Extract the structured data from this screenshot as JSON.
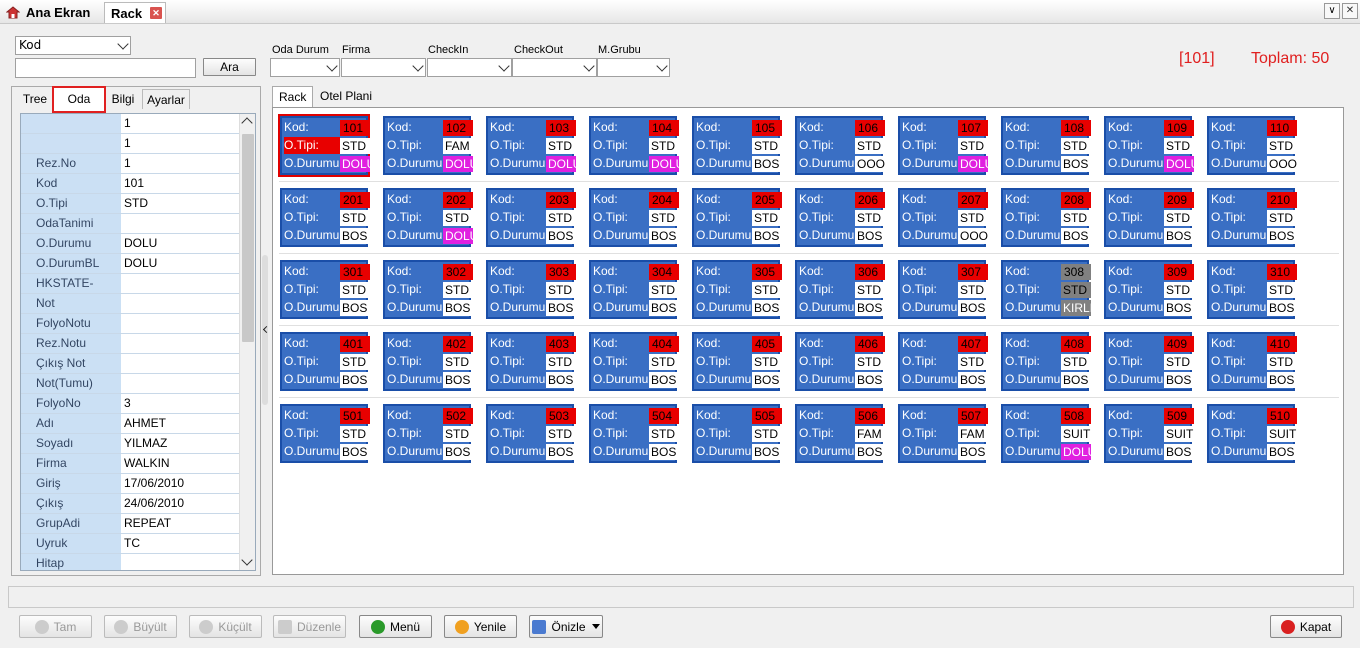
{
  "titlebar": {
    "home_label": "Ana Ekran",
    "rack_label": "Rack",
    "close_glyph": "✕",
    "min_glyph": "∨",
    "x_glyph": "✕"
  },
  "filter": {
    "kod_select": "Kod",
    "search_value": "",
    "ara_label": "Ara",
    "labels": [
      "Oda Durum",
      "Firma",
      "CheckIn",
      "CheckOut",
      "M.Grubu"
    ],
    "selected_room": "[101]",
    "total": "Toplam: 50"
  },
  "left": {
    "tabs": [
      "Tree",
      "Oda",
      "Bilgi",
      "Ayarlar"
    ],
    "rows": [
      {
        "k": "",
        "v": "1"
      },
      {
        "k": "",
        "v": "1"
      },
      {
        "k": "Rez.No",
        "v": "1"
      },
      {
        "k": "Kod",
        "v": "101"
      },
      {
        "k": "O.Tipi",
        "v": "STD"
      },
      {
        "k": "OdaTanimi",
        "v": ""
      },
      {
        "k": "O.Durumu",
        "v": "DOLU"
      },
      {
        "k": "O.DurumBL",
        "v": "DOLU"
      },
      {
        "k": "HKSTATE-",
        "v": ""
      },
      {
        "k": "Not",
        "v": ""
      },
      {
        "k": "FolyoNotu",
        "v": ""
      },
      {
        "k": "Rez.Notu",
        "v": ""
      },
      {
        "k": "Çıkış Not",
        "v": ""
      },
      {
        "k": "Not(Tumu)",
        "v": ""
      },
      {
        "k": "FolyoNo",
        "v": "3"
      },
      {
        "k": "Adı",
        "v": "AHMET"
      },
      {
        "k": "Soyadı",
        "v": "YILMAZ"
      },
      {
        "k": "Firma",
        "v": "WALKIN"
      },
      {
        "k": "Giriş",
        "v": "17/06/2010"
      },
      {
        "k": "Çıkış",
        "v": "24/06/2010"
      },
      {
        "k": "GrupAdi",
        "v": "REPEAT"
      },
      {
        "k": "Uyruk",
        "v": "TC"
      },
      {
        "k": "Hitap",
        "v": ""
      }
    ]
  },
  "rack": {
    "tabs": [
      "Rack",
      "Otel Plani"
    ],
    "labels": {
      "kod": "Kod:",
      "tip": "O.Tipi:",
      "dur": "O.Durumu:"
    },
    "floors": [
      [
        [
          "101",
          "STD",
          "DOLU"
        ],
        [
          "102",
          "FAM",
          "DOLU"
        ],
        [
          "103",
          "STD",
          "DOLU"
        ],
        [
          "104",
          "STD",
          "DOLU"
        ],
        [
          "105",
          "STD",
          "BOS"
        ],
        [
          "106",
          "STD",
          "OOO"
        ],
        [
          "107",
          "STD",
          "DOLU"
        ],
        [
          "108",
          "STD",
          "BOS"
        ],
        [
          "109",
          "STD",
          "DOLU"
        ],
        [
          "110",
          "STD",
          "OOO"
        ]
      ],
      [
        [
          "201",
          "STD",
          "BOS"
        ],
        [
          "202",
          "STD",
          "DOLU"
        ],
        [
          "203",
          "STD",
          "BOS"
        ],
        [
          "204",
          "STD",
          "BOS"
        ],
        [
          "205",
          "STD",
          "BOS"
        ],
        [
          "206",
          "STD",
          "BOS"
        ],
        [
          "207",
          "STD",
          "OOO"
        ],
        [
          "208",
          "STD",
          "BOS"
        ],
        [
          "209",
          "STD",
          "BOS"
        ],
        [
          "210",
          "STD",
          "BOS"
        ]
      ],
      [
        [
          "301",
          "STD",
          "BOS"
        ],
        [
          "302",
          "STD",
          "BOS"
        ],
        [
          "303",
          "STD",
          "BOS"
        ],
        [
          "304",
          "STD",
          "BOS"
        ],
        [
          "305",
          "STD",
          "BOS"
        ],
        [
          "306",
          "STD",
          "BOS"
        ],
        [
          "307",
          "STD",
          "BOS"
        ],
        [
          "308",
          "STD",
          "KIRLI"
        ],
        [
          "309",
          "STD",
          "BOS"
        ],
        [
          "310",
          "STD",
          "BOS"
        ]
      ],
      [
        [
          "401",
          "STD",
          "BOS"
        ],
        [
          "402",
          "STD",
          "BOS"
        ],
        [
          "403",
          "STD",
          "BOS"
        ],
        [
          "404",
          "STD",
          "BOS"
        ],
        [
          "405",
          "STD",
          "BOS"
        ],
        [
          "406",
          "STD",
          "BOS"
        ],
        [
          "407",
          "STD",
          "BOS"
        ],
        [
          "408",
          "STD",
          "BOS"
        ],
        [
          "409",
          "STD",
          "BOS"
        ],
        [
          "410",
          "STD",
          "BOS"
        ]
      ],
      [
        [
          "501",
          "STD",
          "BOS"
        ],
        [
          "502",
          "STD",
          "BOS"
        ],
        [
          "503",
          "STD",
          "BOS"
        ],
        [
          "504",
          "STD",
          "BOS"
        ],
        [
          "505",
          "STD",
          "BOS"
        ],
        [
          "506",
          "FAM",
          "BOS"
        ],
        [
          "507",
          "FAM",
          "BOS"
        ],
        [
          "508",
          "SUIT",
          "DOLU"
        ],
        [
          "509",
          "SUIT",
          "BOS"
        ],
        [
          "510",
          "SUIT",
          "BOS"
        ]
      ]
    ]
  },
  "toolbar": {
    "tam": "Tam",
    "buyult": "Büyült",
    "kucult": "Küçült",
    "duzenle": "Düzenle",
    "menu": "Menü",
    "yenile": "Yenile",
    "onizle": "Önizle",
    "kapat": "Kapat"
  },
  "colors": {
    "room_bg": "#3a6fc4",
    "num_bg": "#e80000",
    "dolu": "#e020e0",
    "kirli": "#808080",
    "accent": "#e00000"
  }
}
